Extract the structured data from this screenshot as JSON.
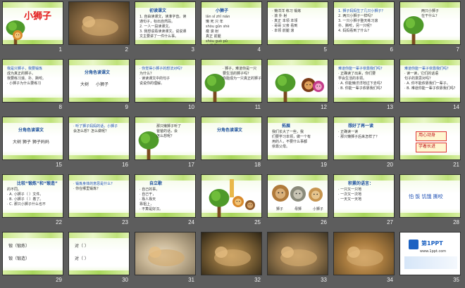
{
  "slides": [
    {
      "n": "1",
      "style": "title",
      "title": "小狮子",
      "lines": [],
      "colors": {
        "accent": "#e31a1a"
      }
    },
    {
      "n": "2",
      "style": "photo",
      "title": "",
      "lines": []
    },
    {
      "n": "3",
      "style": "text",
      "title": "初读课文",
      "lines": [
        "1. 自由读课文，读准字音。读",
        "通句子，标出自然段。",
        "2. 一人一段读课文。",
        "3. 我想说看读读课文，说说课",
        "文主要讲了一件什么事。"
      ]
    },
    {
      "n": "4",
      "style": "pinyin",
      "title": "小狮子",
      "lines": [
        "lǎn   sǐ   zhǐ  nián",
        "懒   死  只  年",
        "shòu  gǔn  shè",
        "瘦   滚  射",
        "真正    前腿",
        "shòu  guò  pū",
        "本领   翻过"
      ]
    },
    {
      "n": "5",
      "style": "words",
      "title": "",
      "lines": [
        "· 懒洋洋  练习  锻炼",
        "· 滚   扑   射",
        "· 真正  本领  本领",
        "· 哥哥  父亲  看到",
        "· 本领   前腿  滚"
      ]
    },
    {
      "n": "6",
      "style": "text",
      "title": "",
      "lines": [
        "1. 狮子妈妈生了几只小狮子？",
        "2. 两只小狮子一样吗？",
        "3. 一只小狮子整天练习滚",
        "  扑、撕咬，另一只呢？",
        "4. 妈妈看到了什么？"
      ]
    },
    {
      "n": "7",
      "style": "tree",
      "title": "",
      "lines": [
        "两只小狮子",
        "在干什么？"
      ]
    },
    {
      "n": "8",
      "style": "text",
      "title": "",
      "lines": [
        "我是只狮子，我要锻炼",
        "成为真正的狮子。",
        "我要练习滚、扑、撕咬。",
        "· 小狮子为什么要练习"
      ]
    },
    {
      "n": "9",
      "style": "roles",
      "title": "分角色读课文",
      "lines": [
        "大树",
        "小狮子"
      ]
    },
    {
      "n": "10",
      "style": "text",
      "title": "",
      "lines": [
        "· 你觉得小狮子的想法对吗？",
        "  为什么？",
        "· 读读课文中的句子",
        "  说说你的理解。"
      ]
    },
    {
      "n": "11",
      "style": "tree",
      "title": "",
      "lines": [
        "· 狮子，难道你是一只",
        "  要生活的狮子吗？",
        "  你能成为一只真正的狮子吗？"
      ]
    },
    {
      "n": "12",
      "style": "cartoon",
      "title": "",
      "lines": []
    },
    {
      "n": "13",
      "style": "text",
      "title": "",
      "lines": [
        "难道你能一辈子依靠我们吗？",
        "· 正确读了出来，你们要",
        "  学会生活的本领。",
        "· A. 你能懒洋洋地过下去吗？",
        "· B. 你能一辈子依靠我们吗？"
      ]
    },
    {
      "n": "14",
      "style": "text",
      "title": "",
      "lines": [
        "难道你能一辈子依靠我们吗？",
        "· 读一读，它们的话语",
        "  句子的意思对吗？",
        "· A. 你不能依靠我们一辈子。",
        "· B. 难道你能一辈子依靠我们吗？"
      ]
    },
    {
      "n": "15",
      "style": "roles",
      "title": "分角色读课文",
      "lines": [
        "大树    狮子    狮子妈妈"
      ]
    },
    {
      "n": "16",
      "style": "text",
      "title": "",
      "lines": [
        "· 听了狮子妈妈的话，小狮子",
        "  会怎么想？怎么做呢？"
      ]
    },
    {
      "n": "17",
      "style": "tree",
      "title": "",
      "lines": [
        "那只懒狮子听了",
        "爸爸的话，会",
        "怎么想呢？"
      ]
    },
    {
      "n": "18",
      "style": "roles",
      "title": "分角色读课文",
      "lines": []
    },
    {
      "n": "19",
      "style": "text",
      "title": "拓展",
      "lines": [
        "我们长大了一些，我",
        "们要学习本领，做一个有",
        "用的人，不要什么事都",
        "依靠父母。"
      ]
    },
    {
      "n": "20",
      "style": "text",
      "title": "想好了再一读",
      "lines": [
        "· 正确读一读",
        "· 那只懒狮子后来怎样了？"
      ]
    },
    {
      "n": "21",
      "style": "stamps",
      "title": "",
      "lines": [
        "用心动身",
        "学着长进"
      ]
    },
    {
      "n": "22",
      "style": "text",
      "title": "比较“锻炼”和“锻造”",
      "lines": [
        "的不同。",
        "· A. 小狮子（  ）文件。",
        "· B. 小狮子（  ）着了。",
        "· C. 那只小狮子什么也不"
      ]
    },
    {
      "n": "23",
      "style": "text",
      "title": "",
      "lines": [
        "· 锻炼身体的意思是什么？",
        "· 你在哪里锻炼？"
      ]
    },
    {
      "n": "24",
      "style": "text",
      "title": "自立歌",
      "lines": [
        "· 自己的事，",
        "· 自己干，",
        "· 靠人靠天",
        "  靠祖上，",
        "· 不算是好汉。"
      ]
    },
    {
      "n": "25",
      "style": "animals",
      "title": "",
      "lines": []
    },
    {
      "n": "26",
      "style": "lions",
      "title": "",
      "lines": [
        "狮子",
        "母狮",
        "小狮子"
      ]
    },
    {
      "n": "27",
      "style": "text",
      "title": "积累的语言：",
      "lines": [
        "· 一只又一只地",
        "· 一次又一次地",
        "· 一天又一天地"
      ]
    },
    {
      "n": "28",
      "style": "words2",
      "title": "",
      "lines": [
        "怕  饭  饥饿  撕咬"
      ]
    },
    {
      "n": "29",
      "style": "fill",
      "title": "",
      "lines": [
        "锻（锻炼）",
        "锻（锻造）"
      ]
    },
    {
      "n": "30",
      "style": "fill2",
      "title": "",
      "lines": [
        "对（      ）",
        "对（      ）"
      ]
    },
    {
      "n": "31",
      "style": "photo",
      "title": "",
      "lines": []
    },
    {
      "n": "32",
      "style": "photo",
      "title": "",
      "lines": []
    },
    {
      "n": "33",
      "style": "photo",
      "title": "",
      "lines": []
    },
    {
      "n": "34",
      "style": "photo",
      "title": "",
      "lines": []
    },
    {
      "n": "35",
      "style": "logo",
      "title": "第1PPT",
      "lines": [
        "www.1ppt.com"
      ]
    }
  ]
}
